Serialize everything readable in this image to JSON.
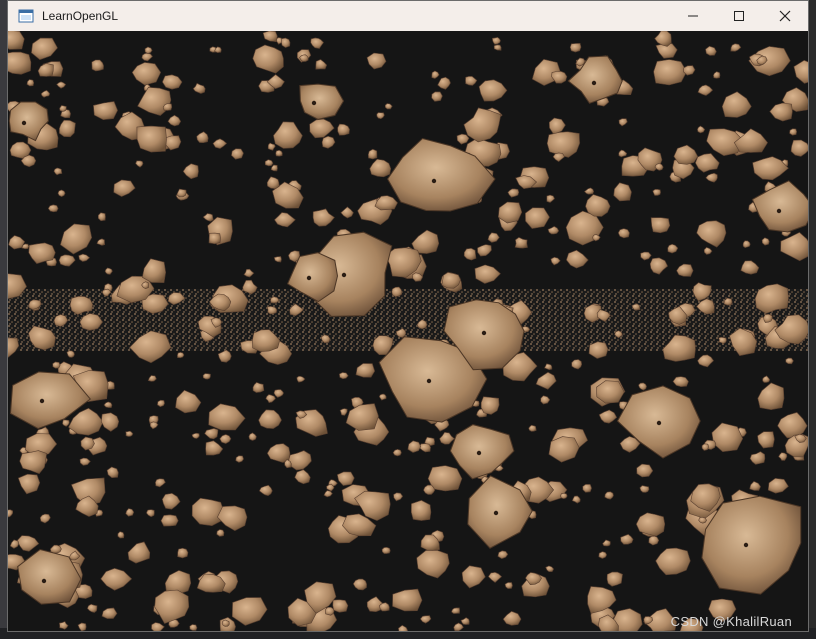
{
  "window": {
    "title": "LearnOpenGL",
    "icon": "app-window-icon",
    "controls": {
      "minimize": "minimize-icon",
      "maximize": "maximize-icon",
      "close": "close-icon"
    }
  },
  "viewport": {
    "description_icon": "opengl-render-canvas",
    "background_color": "#151515",
    "rock_color": "#b08a66",
    "ring_color": "#8a6f55"
  },
  "watermark": {
    "text": "CSDN @KhalilRuan"
  }
}
